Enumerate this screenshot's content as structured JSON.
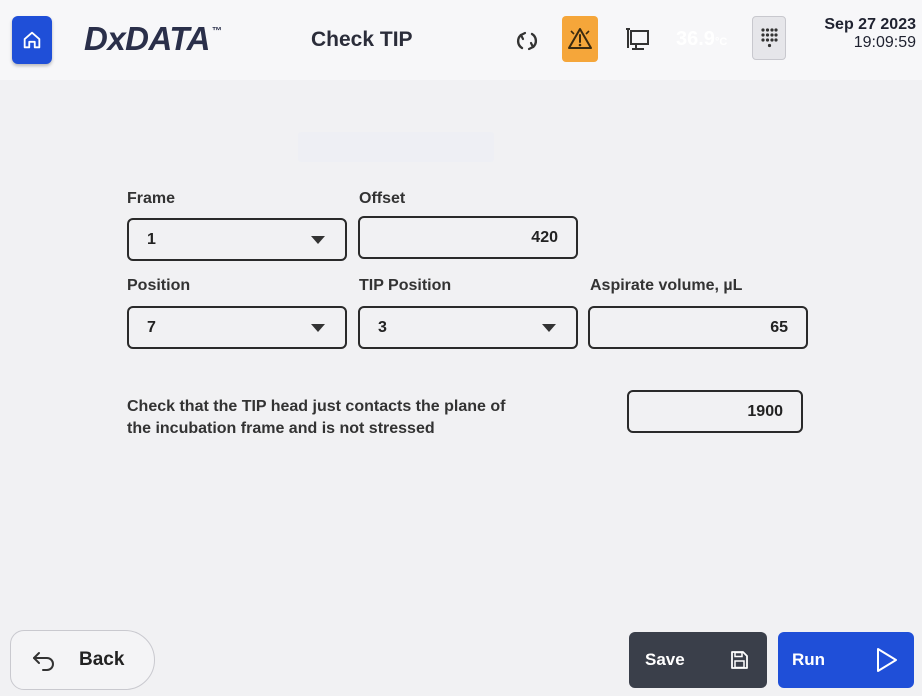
{
  "header": {
    "home_icon": "home-icon",
    "logo_text": "DxDATA",
    "logo_tm": "™",
    "title": "Check TIP",
    "sync_icon": "sync-icon",
    "warning_icon": "warning-icon",
    "computer_icon": "computer-icon",
    "temperature_value": "36.9",
    "temperature_unit": "°C",
    "keypad_icon": "keypad-icon",
    "date": "Sep 27 2023",
    "time": "19:09:59"
  },
  "form": {
    "frame": {
      "label": "Frame",
      "value": "1"
    },
    "offset": {
      "label": "Offset",
      "value": "420"
    },
    "position": {
      "label": "Position",
      "value": "7"
    },
    "tip_position": {
      "label": "TIP Position",
      "value": "3"
    },
    "aspirate_volume": {
      "label": "Aspirate volume, µL",
      "value": "65"
    },
    "instruction_line1": "Check that the TIP head just contacts the plane of",
    "instruction_line2": "the incubation frame and is not stressed",
    "contact_value": "1900"
  },
  "footer": {
    "back_label": "Back",
    "save_label": "Save",
    "run_label": "Run"
  },
  "colors": {
    "accent_blue": "#1f4fd8",
    "warning_orange": "#f5a63a",
    "save_dark": "#3a3f4a",
    "background": "#f1f1f3"
  }
}
